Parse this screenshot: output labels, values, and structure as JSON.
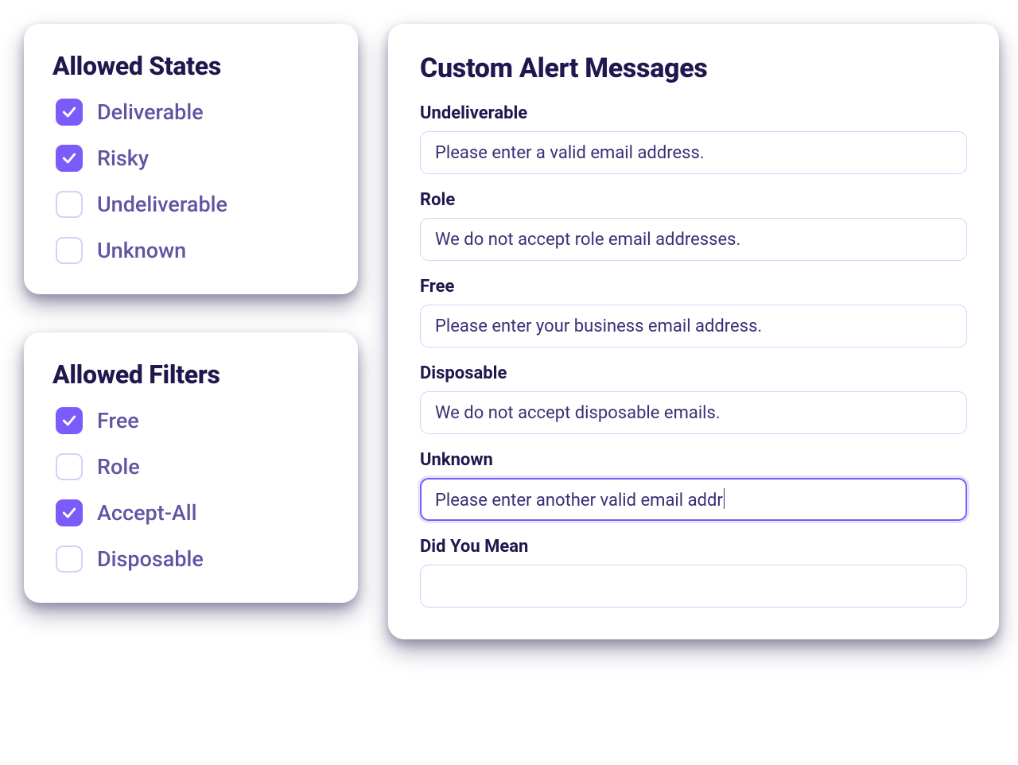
{
  "allowed_states": {
    "title": "Allowed States",
    "items": [
      {
        "label": "Deliverable",
        "checked": true
      },
      {
        "label": "Risky",
        "checked": true
      },
      {
        "label": "Undeliverable",
        "checked": false
      },
      {
        "label": "Unknown",
        "checked": false
      }
    ]
  },
  "allowed_filters": {
    "title": "Allowed Filters",
    "items": [
      {
        "label": "Free",
        "checked": true
      },
      {
        "label": "Role",
        "checked": false
      },
      {
        "label": "Accept-All",
        "checked": true
      },
      {
        "label": "Disposable",
        "checked": false
      }
    ]
  },
  "custom_alerts": {
    "title": "Custom Alert Messages",
    "fields": [
      {
        "key": "undeliverable",
        "label": "Undeliverable",
        "value": "Please enter a valid email address.",
        "focused": false
      },
      {
        "key": "role",
        "label": "Role",
        "value": "We do not accept role email addresses.",
        "focused": false
      },
      {
        "key": "free",
        "label": "Free",
        "value": "Please enter your business email address.",
        "focused": false
      },
      {
        "key": "disposable",
        "label": "Disposable",
        "value": "We do not accept disposable emails.",
        "focused": false
      },
      {
        "key": "unknown",
        "label": "Unknown",
        "value": "Please enter another valid email addr",
        "focused": true
      },
      {
        "key": "did_you_mean",
        "label": "Did You Mean",
        "value": "",
        "focused": false
      }
    ]
  }
}
